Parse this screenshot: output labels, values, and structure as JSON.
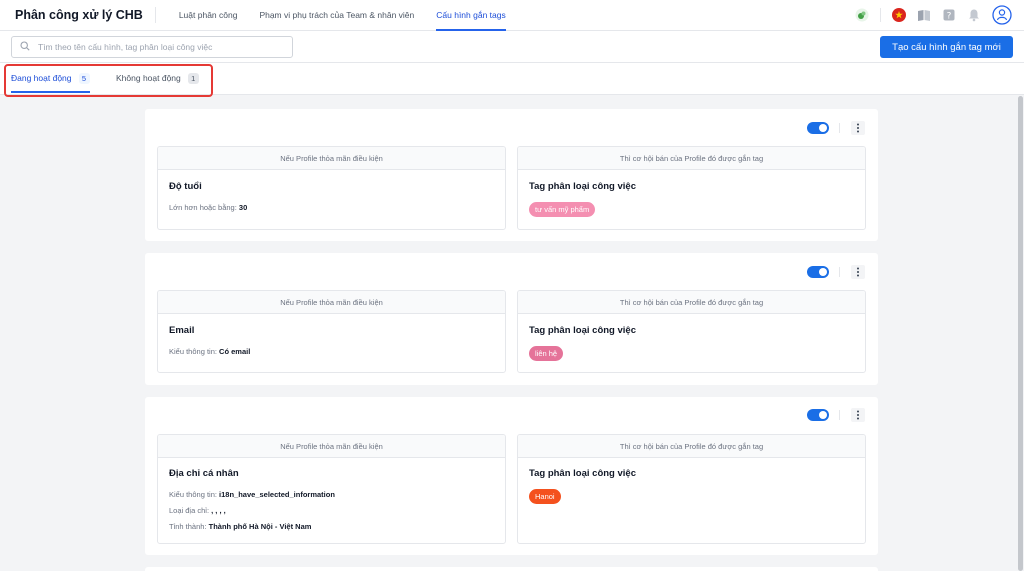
{
  "header": {
    "title": "Phân công xử lý CHB",
    "nav": [
      {
        "label": "Luật phân công",
        "active": false
      },
      {
        "label": "Phạm vi phụ trách của Team & nhân viên",
        "active": false
      },
      {
        "label": "Cấu hình gắn tags",
        "active": true
      }
    ],
    "icons": [
      "status-dot-icon",
      "vietnam-flag-icon",
      "book-icon",
      "help-icon",
      "bell-icon",
      "user-avatar-icon"
    ]
  },
  "toolbar": {
    "search_placeholder": "Tìm theo tên cấu hình, tag phân loại công việc",
    "create_button": "Tạo cấu hình gắn tag mới"
  },
  "tabs": [
    {
      "label": "Đang hoạt động",
      "count": "5",
      "active": true
    },
    {
      "label": "Không hoạt động",
      "count": "1",
      "active": false
    }
  ],
  "colors": {
    "accent": "#1a6ee6",
    "highlight": "#e53935",
    "tag_pink": "#f48fb1",
    "tag_rose": "#e57399",
    "tag_red": "#f4511e"
  },
  "cards": [
    {
      "enabled": true,
      "condition_header": "Nếu Profile thỏa mãn điều kiện",
      "action_header": "Thì cơ hội bán của Profile đó được gắn tag",
      "condition_title": "Độ tuổi",
      "conditions": [
        {
          "label": "Lớn hơn hoặc bằng:",
          "value": "30"
        }
      ],
      "action_title": "Tag phân loại công việc",
      "tag": "tư vấn mỹ phẩm",
      "tag_color": "#f48fb1"
    },
    {
      "enabled": true,
      "condition_header": "Nếu Profile thỏa mãn điều kiện",
      "action_header": "Thì cơ hội bán của Profile đó được gắn tag",
      "condition_title": "Email",
      "conditions": [
        {
          "label": "Kiểu thông tin:",
          "value": "Có email"
        }
      ],
      "action_title": "Tag phân loại công việc",
      "tag": "liên hệ",
      "tag_color": "#e57399"
    },
    {
      "enabled": true,
      "condition_header": "Nếu Profile thỏa mãn điều kiện",
      "action_header": "Thì cơ hội bán của Profile đó được gắn tag",
      "condition_title": "Địa chỉ cá nhân",
      "conditions": [
        {
          "label": "Kiểu thông tin:",
          "value": "i18n_have_selected_information"
        },
        {
          "label": "Loại địa chỉ:",
          "value": ", , , ,"
        },
        {
          "label": "Tỉnh thành:",
          "value": "Thành phố Hà Nội - Việt Nam"
        }
      ],
      "action_title": "Tag phân loại công việc",
      "tag": "Hanoi",
      "tag_color": "#f4511e"
    }
  ]
}
